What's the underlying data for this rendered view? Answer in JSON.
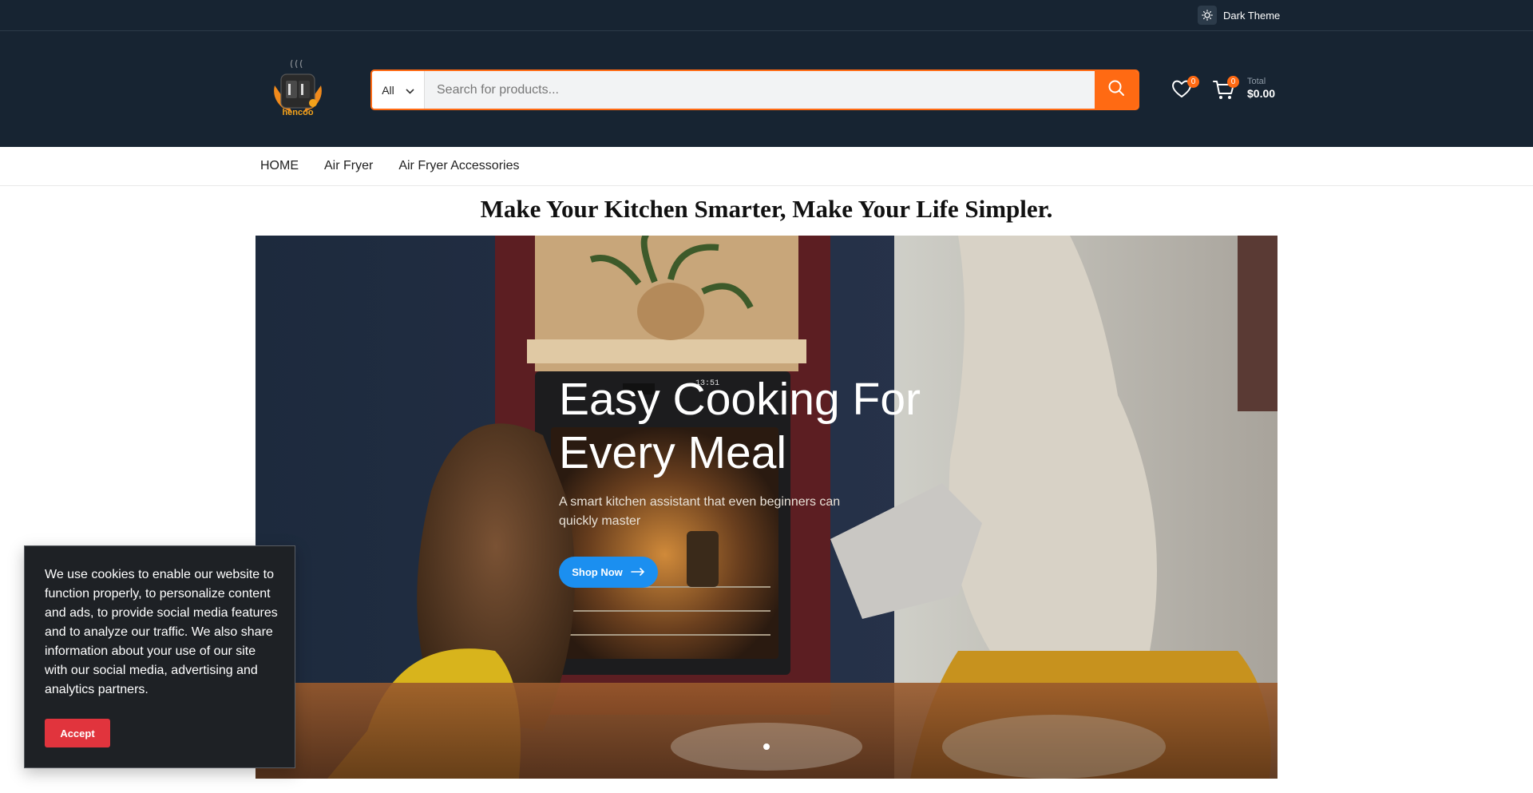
{
  "topbar": {
    "theme_label": "Dark Theme"
  },
  "header": {
    "logo_text": "hencoo",
    "search": {
      "category": "All",
      "placeholder": "Search for products..."
    },
    "wishlist_count": "0",
    "cart_count": "0",
    "cart_total_label": "Total",
    "cart_total_value": "$0.00"
  },
  "nav": {
    "items": [
      "HOME",
      "Air Fryer",
      "Air Fryer Accessories"
    ]
  },
  "headline": "Make Your Kitchen Smarter, Make Your Life Simpler.",
  "hero": {
    "title_line1": "Easy Cooking For",
    "title_line2": "Every Meal",
    "subtitle": "A smart kitchen assistant that even beginners can quickly master",
    "button_label": "Shop Now",
    "oven_clock": "13:51"
  },
  "cookie": {
    "text": "We use cookies to enable our website to function properly, to personalize content and ads, to provide social media features and to analyze our traffic. We also share information about your use of our site with our social media, advertising and analytics partners.",
    "accept_label": "Accept"
  },
  "colors": {
    "accent": "#ff6a13",
    "header_bg": "#172432",
    "cta_blue": "#1b8ff0",
    "accept_red": "#e1343d"
  }
}
